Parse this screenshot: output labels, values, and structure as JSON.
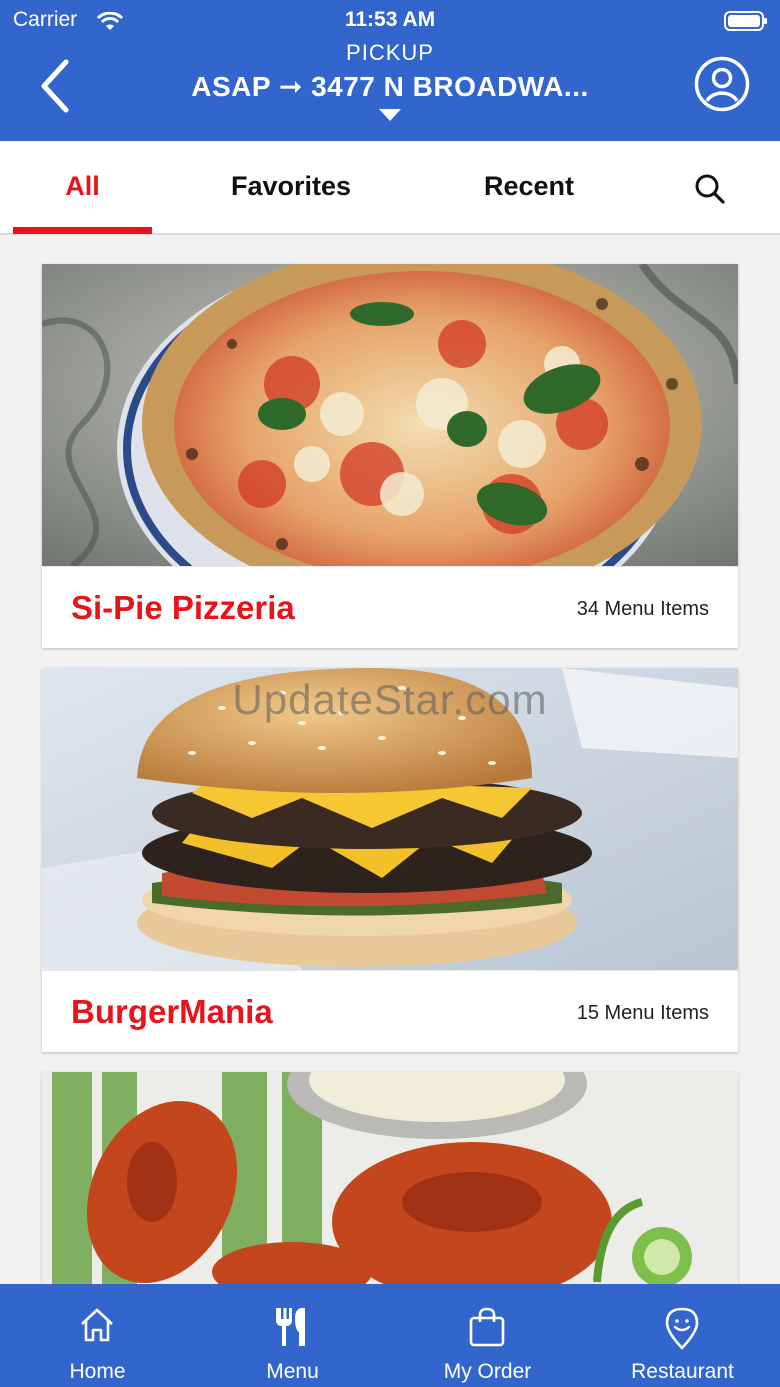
{
  "status_bar": {
    "carrier": "Carrier",
    "time": "11:53 AM"
  },
  "header": {
    "mode": "PICKUP",
    "when": "ASAP",
    "arrow": "➞",
    "address": "3477 N BROADWA..."
  },
  "tabs": [
    {
      "label": "All",
      "active": true
    },
    {
      "label": "Favorites",
      "active": false
    },
    {
      "label": "Recent",
      "active": false
    }
  ],
  "restaurants": [
    {
      "name": "Si-Pie Pizzeria",
      "items": "34 Menu Items",
      "image": "pizza"
    },
    {
      "name": "BurgerMania",
      "items": "15 Menu Items",
      "image": "burger"
    },
    {
      "name": "",
      "items": "",
      "image": "chicken-wings"
    }
  ],
  "watermark": "UpdateStar.com",
  "bottom_nav": [
    {
      "label": "Home",
      "icon": "home-icon"
    },
    {
      "label": "Menu",
      "icon": "fork-knife-icon"
    },
    {
      "label": "My Order",
      "icon": "bag-icon"
    },
    {
      "label": "Restaurant",
      "icon": "location-pin-icon"
    }
  ],
  "colors": {
    "brand_blue": "#3366cc",
    "accent_red": "#e8141b"
  }
}
